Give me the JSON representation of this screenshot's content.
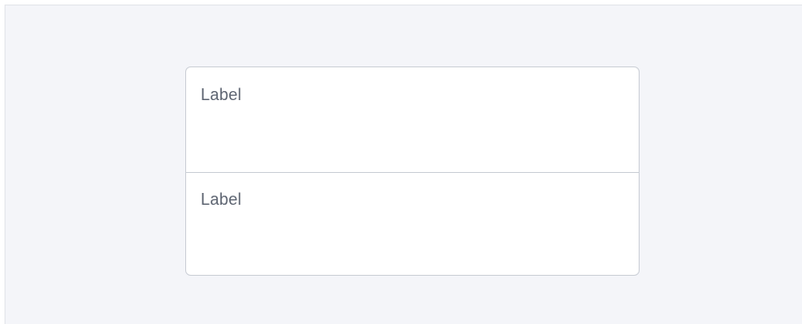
{
  "form": {
    "fields": [
      {
        "label": "Label",
        "value": ""
      },
      {
        "label": "Label",
        "value": ""
      }
    ]
  },
  "colors": {
    "page_background": "#f4f5f9",
    "card_background": "#ffffff",
    "border": "#cdd1d8",
    "label_text": "#5c6370"
  }
}
